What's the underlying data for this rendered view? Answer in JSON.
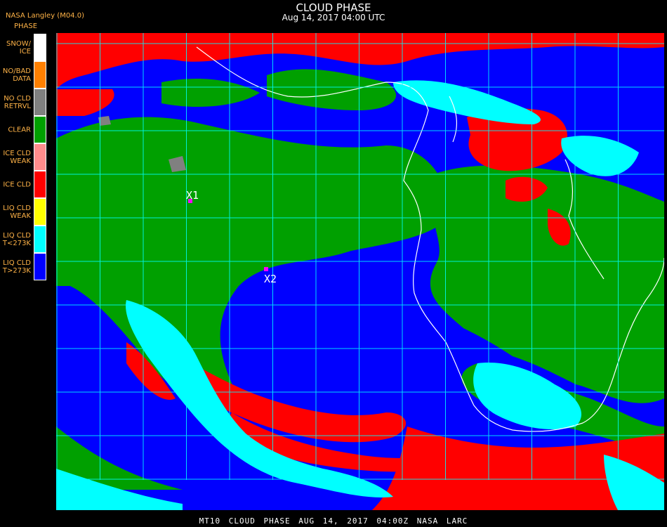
{
  "header": {
    "title": "CLOUD PHASE",
    "subtitle": "Aug 14, 2017 04:00 UTC",
    "brand": "NASA Langley (M04.0)",
    "legend_title": "PHASE"
  },
  "legend": [
    {
      "label": "SNOW/\nICE",
      "color": "#ffffff"
    },
    {
      "label": "NO/BAD\nDATA",
      "color": "#ff8000"
    },
    {
      "label": "NO CLD\nRETRVL",
      "color": "#808080"
    },
    {
      "label": "CLEAR",
      "color": "#00a000"
    },
    {
      "label": "ICE CLD\nWEAK",
      "color": "#ff8c8c"
    },
    {
      "label": "ICE CLD",
      "color": "#ff0000"
    },
    {
      "label": "LIQ CLD\nWEAK",
      "color": "#ffff00"
    },
    {
      "label": "LIQ CLD\nT<273K",
      "color": "#00ffff"
    },
    {
      "label": "LIQ CLD\nT>273K",
      "color": "#0000ff"
    }
  ],
  "markers": [
    {
      "label": "X1"
    },
    {
      "label": "X2"
    }
  ],
  "footer": "MT10 CLOUD PHASE AUG 14, 2017 04:00Z NASA LARC",
  "colors": {
    "ocean_liquid": "#0000ff",
    "clear": "#00a000",
    "ice": "#ff0000",
    "liquid_cold": "#00ffff",
    "grid": "#00ffff",
    "coast": "#ffffff",
    "marker": "#ff00ff"
  }
}
